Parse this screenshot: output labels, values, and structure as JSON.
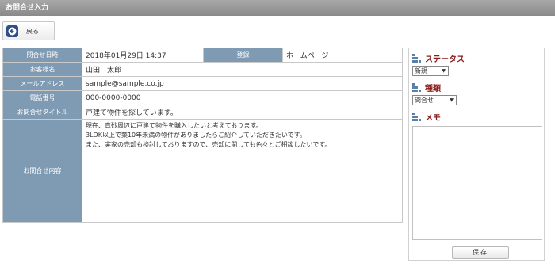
{
  "header": {
    "title": "お問合せ入力"
  },
  "toolbar": {
    "back_label": "戻る"
  },
  "info": {
    "date_label": "問合せ日時",
    "date_value": "2018年01月29日 14:37",
    "registered_label": "登録",
    "registered_value": "ホームページ",
    "name_label": "お客様名",
    "name_value": "山田　太郎",
    "email_label": "メールアドレス",
    "email_value": "sample@sample.co.jp",
    "phone_label": "電話番号",
    "phone_value": "000-0000-0000",
    "subject_label": "お問合せタイトル",
    "subject_value": "戸建て物件を探しています。",
    "content_label": "お問合せ内容",
    "content_lines": [
      "現在、真砂周辺に戸建て物件を購入したいと考えております。",
      "3LDK以上で築10年未満の物件がありましたらご紹介していただきたいです。",
      "また、実家の売却も検討しておりますので、売却に関しても色々とご相談したいです。"
    ]
  },
  "side": {
    "status_title": "ステータス",
    "status_selected": "新規",
    "type_title": "種類",
    "type_selected": "問合せ",
    "memo_title": "メモ",
    "memo_value": "",
    "save_label": "保存"
  },
  "colors": {
    "label_bg": "#7f9ab3",
    "section_title": "#8b1a1a",
    "icon": "#5a7fa8"
  }
}
